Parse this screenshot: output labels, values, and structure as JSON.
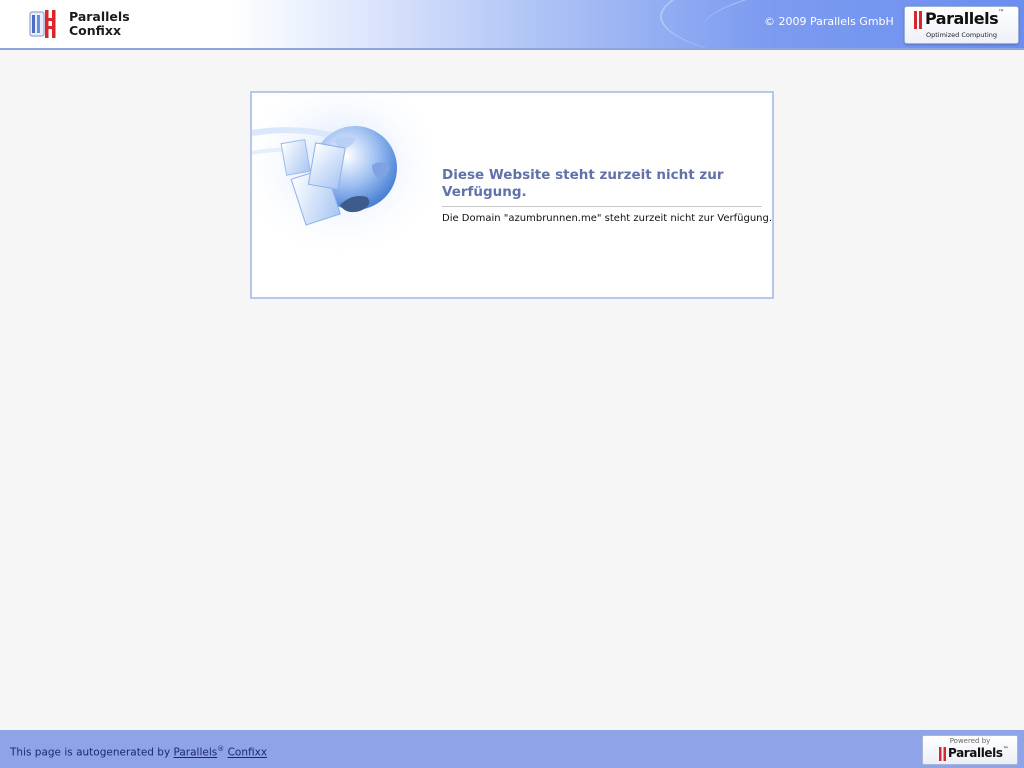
{
  "header": {
    "app_name_line1": "Parallels",
    "app_name_line2": "Confixx",
    "copyright": "© 2009 Parallels GmbH",
    "brand": {
      "name": "Parallels",
      "trademark": "™",
      "tagline": "Optimized Computing"
    }
  },
  "notice": {
    "title": "Diese Website steht zurzeit nicht zur Verfügung.",
    "message": "Die Domain \"azumbrunnen.me\" steht zurzeit nicht zur Verfügung."
  },
  "footer": {
    "prefix": "This page is autogenerated by ",
    "link_parallels": "Parallels",
    "registered": "®",
    "link_confixx": "Confixx",
    "powered_label": "Powered by",
    "powered_brand": "Parallels",
    "powered_trademark": "™"
  },
  "colors": {
    "brand_red": "#d9262c",
    "title_blue": "#6072a9",
    "footer_blue": "#8fa4e8"
  }
}
